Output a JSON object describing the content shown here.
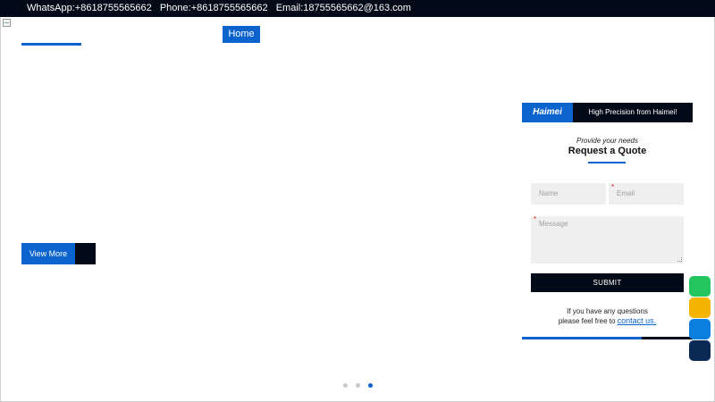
{
  "topbar": {
    "whatsapp": "WhatsApp:+8618755565662",
    "phone": "Phone:+8618755565662",
    "email": "Email:18755565662@163.com"
  },
  "nav": {
    "home_label": "Home"
  },
  "hero": {
    "view_more_label": "View More",
    "slides": {
      "count": 3,
      "active_index": 2
    }
  },
  "quote_form": {
    "brand": "Haimei",
    "tagline": "High Precision from Haimei!",
    "provide_text": "Provide your needs",
    "title": "Request a Quote",
    "name_placeholder": "Name",
    "email_placeholder": "Email",
    "message_placeholder": "Message",
    "required_mark": "*",
    "submit_label": "SUBMIT",
    "help_line1": "If you have any questions",
    "help_line2": "please feel free to",
    "contact_link": "contact us."
  },
  "side_buttons": [
    {
      "name": "green-contact-button",
      "color": "#22c55e"
    },
    {
      "name": "yellow-contact-button",
      "color": "#f5b400"
    },
    {
      "name": "blue-contact-button",
      "color": "#0b7fe0"
    },
    {
      "name": "navy-contact-button",
      "color": "#0a2a55"
    }
  ],
  "colors": {
    "accent": "#0b63ce",
    "dark": "#020a17"
  }
}
